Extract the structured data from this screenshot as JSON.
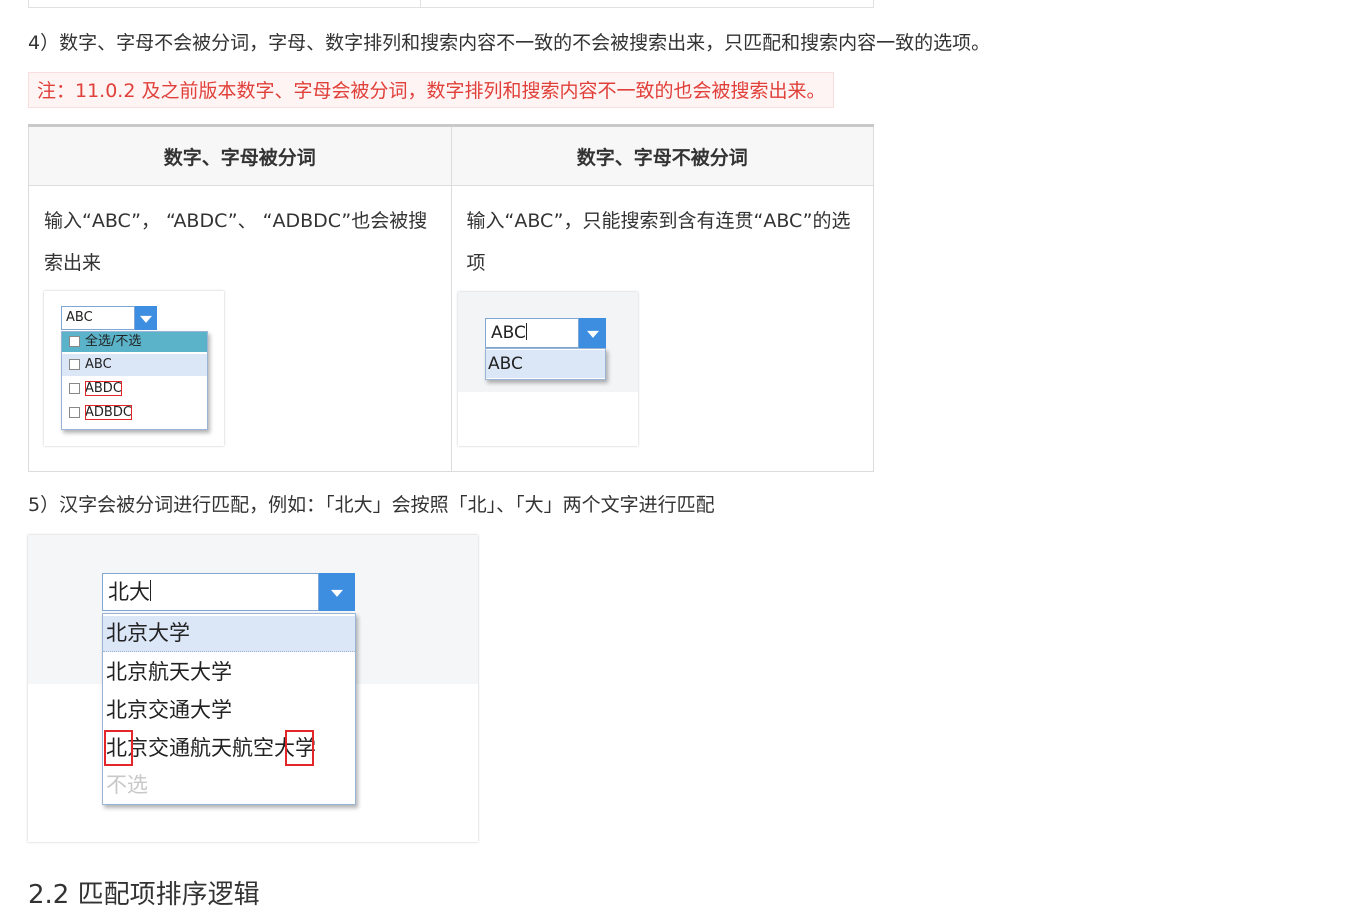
{
  "paragraphs": {
    "p4": "4）数字、字母不会被分词，字母、数字排列和搜索内容不一致的不会被搜索出来，只匹配和搜索内容一致的选项。",
    "note": "注：11.0.2 及之前版本数字、字母会被分词，数字排列和搜索内容不一致的也会被搜索出来。",
    "p5": "5）汉字会被分词进行匹配，例如：「北大」会按照「北」、「大」两个文字进行匹配",
    "next_heading": "2.2 匹配项排序逻辑"
  },
  "table": {
    "headers": [
      "数字、字母被分词",
      "数字、字母不被分词"
    ],
    "cells": [
      "输入“ABC”， “ABDC”、 “ADBDC”也会被搜索出来",
      "输入“ABC”，只能搜索到含有连贯“ABC”的选项"
    ]
  },
  "shot1": {
    "input": "ABC",
    "select_all": "全选/不选",
    "options": [
      "ABC",
      "ABDC",
      "ADBDC"
    ]
  },
  "shot2": {
    "input": "ABC",
    "options": [
      "ABC"
    ]
  },
  "shot3": {
    "input": "北大",
    "options": [
      "北京大学",
      "北京航天大学",
      "北京交通大学",
      "北京交通航天航空大学"
    ],
    "none": "不选"
  },
  "colors": {
    "accent": "#3d8ee0",
    "note_text": "#e0403a",
    "highlight_box": "#e3262a",
    "selected_row": "#dbe6f7",
    "select_all_row": "#5bb3c9"
  }
}
